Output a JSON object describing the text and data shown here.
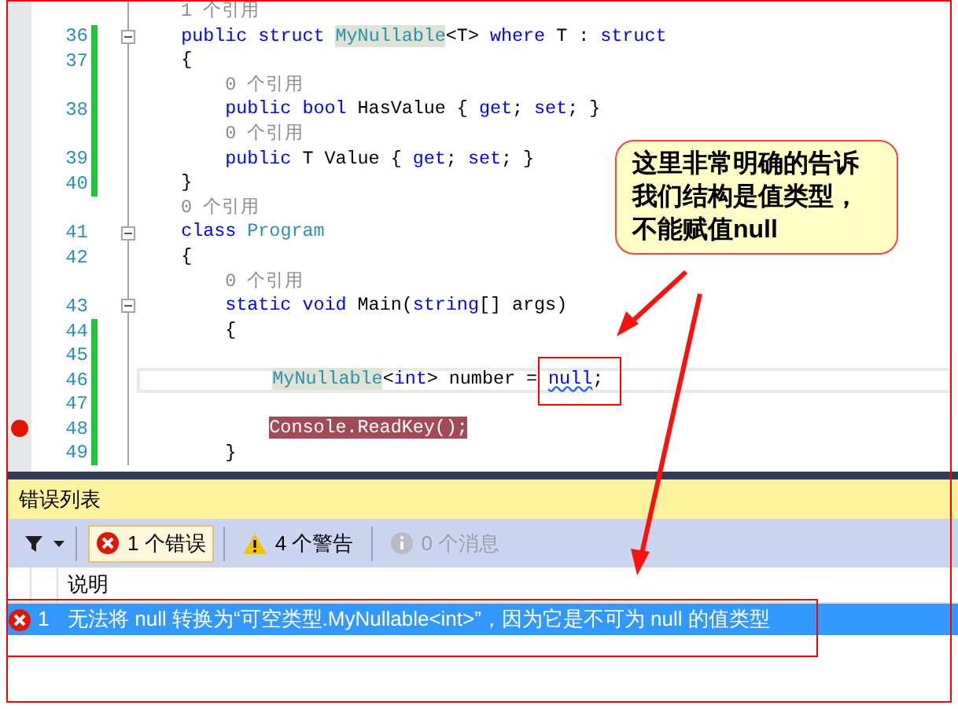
{
  "editor": {
    "lines": [
      {
        "kind": "lens",
        "text": "    1 个引用",
        "changed": false
      },
      {
        "kind": "code",
        "number": "36",
        "changed": true,
        "fold": true,
        "tokens": [
          {
            "text": "    public",
            "kind": "keyword"
          },
          {
            "text": " struct",
            "kind": "keyword"
          },
          {
            "text": " MyNullable",
            "kind": "type_ref"
          },
          {
            "text": "<T> ",
            "kind": "plain"
          },
          {
            "text": "where",
            "kind": "keyword"
          },
          {
            "text": " T : ",
            "kind": "plain"
          },
          {
            "text": "struct",
            "kind": "keyword"
          }
        ]
      },
      {
        "kind": "code",
        "number": "37",
        "changed": true,
        "tokens": [
          {
            "text": "    {",
            "kind": "plain"
          }
        ]
      },
      {
        "kind": "lens",
        "text": "        0 个引用",
        "changed": true
      },
      {
        "kind": "code",
        "number": "38",
        "changed": true,
        "tokens": [
          {
            "text": "        public",
            "kind": "keyword"
          },
          {
            "text": " bool",
            "kind": "keyword"
          },
          {
            "text": " HasValue { ",
            "kind": "plain"
          },
          {
            "text": "get",
            "kind": "keyword"
          },
          {
            "text": "; ",
            "kind": "plain"
          },
          {
            "text": "set",
            "kind": "keyword"
          },
          {
            "text": "; }",
            "kind": "plain"
          }
        ]
      },
      {
        "kind": "lens",
        "text": "        0 个引用",
        "changed": true
      },
      {
        "kind": "code",
        "number": "39",
        "changed": true,
        "tokens": [
          {
            "text": "        public",
            "kind": "keyword"
          },
          {
            "text": " T Value { ",
            "kind": "plain"
          },
          {
            "text": "get",
            "kind": "keyword"
          },
          {
            "text": "; ",
            "kind": "plain"
          },
          {
            "text": "set",
            "kind": "keyword"
          },
          {
            "text": "; }",
            "kind": "plain"
          }
        ]
      },
      {
        "kind": "code",
        "number": "40",
        "changed": true,
        "tokens": [
          {
            "text": "    }",
            "kind": "plain"
          }
        ]
      },
      {
        "kind": "lens",
        "text": "    0 个引用",
        "changed": false
      },
      {
        "kind": "code",
        "number": "41",
        "changed": false,
        "fold": true,
        "tokens": [
          {
            "text": "    class",
            "kind": "keyword"
          },
          {
            "text": " Program",
            "kind": "type"
          }
        ]
      },
      {
        "kind": "code",
        "number": "42",
        "changed": false,
        "tokens": [
          {
            "text": "    {",
            "kind": "plain"
          }
        ]
      },
      {
        "kind": "lens",
        "text": "        0 个引用",
        "changed": false
      },
      {
        "kind": "code",
        "number": "43",
        "changed": false,
        "fold": true,
        "tokens": [
          {
            "text": "        static",
            "kind": "keyword"
          },
          {
            "text": " void",
            "kind": "keyword"
          },
          {
            "text": " Main(",
            "kind": "plain"
          },
          {
            "text": "string",
            "kind": "keyword"
          },
          {
            "text": "[] args)",
            "kind": "plain"
          }
        ]
      },
      {
        "kind": "code",
        "number": "44",
        "changed": true,
        "tokens": [
          {
            "text": "        {",
            "kind": "plain"
          }
        ]
      },
      {
        "kind": "code",
        "number": "45",
        "changed": true
      },
      {
        "kind": "code",
        "number": "46",
        "changed": true,
        "current": true,
        "tokens": [
          {
            "text": "            MyNullable",
            "kind": "type_ref"
          },
          {
            "text": "<",
            "kind": "plain"
          },
          {
            "text": "int",
            "kind": "keyword"
          },
          {
            "text": "> number = ",
            "kind": "plain"
          },
          {
            "text": "null",
            "kind": "error_keyword"
          },
          {
            "text": ";",
            "kind": "plain"
          }
        ]
      },
      {
        "kind": "code",
        "number": "47",
        "changed": true
      },
      {
        "kind": "code",
        "number": "48",
        "changed": true,
        "breakpoint": true,
        "tokens": [
          {
            "text": "            Console.ReadKey();",
            "kind": "breakpoint_text"
          }
        ]
      },
      {
        "kind": "code",
        "number": "49",
        "changed": true,
        "tokens": [
          {
            "text": "        }",
            "kind": "plain"
          }
        ]
      }
    ]
  },
  "callout": {
    "text": "这里非常明确的告诉我们结构是值类型，不能赋值null"
  },
  "error_list": {
    "title": "错误列表",
    "filters": [
      {
        "kind": "error",
        "label": "1 个错误",
        "selected": true,
        "disabled": false
      },
      {
        "kind": "warning",
        "label": "4 个警告",
        "selected": false,
        "disabled": false
      },
      {
        "kind": "info",
        "label": "0 个消息",
        "selected": false,
        "disabled": true
      }
    ],
    "columns": [
      "说明"
    ],
    "rows": [
      {
        "kind": "error",
        "number": "1",
        "description": "无法将 null 转换为“可空类型.MyNullable<int>”，因为它是不可为 null 的值类型",
        "selected": true
      }
    ]
  }
}
